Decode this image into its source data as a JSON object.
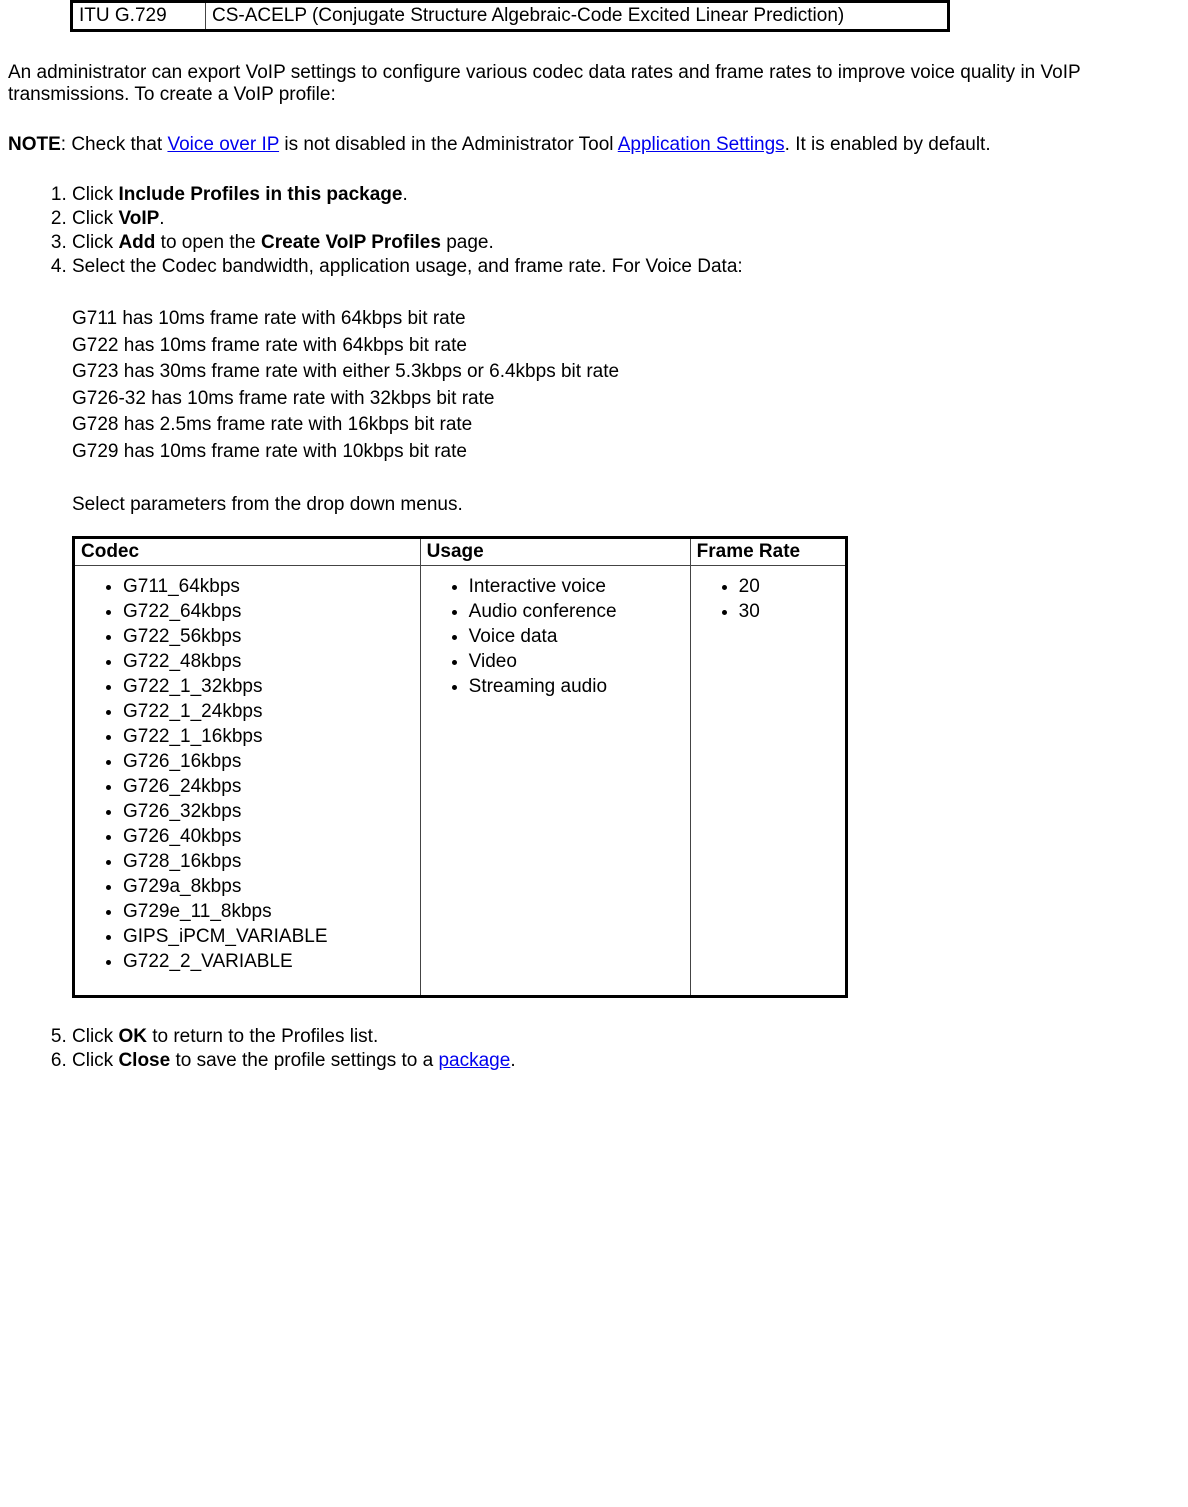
{
  "topTable": {
    "cell1": "ITU G.729",
    "cell2": "CS-ACELP (Conjugate Structure Algebraic-Code Excited Linear Prediction)"
  },
  "intro": "An administrator can export VoIP settings to configure various codec data rates and frame rates to improve voice quality in VoIP transmissions. To create a VoIP profile:",
  "note": {
    "prefix": "NOTE",
    "beforeLink1": ": Check that ",
    "link1": "Voice over IP",
    "middle": " is not disabled in the Administrator Tool ",
    "link2": "Application Settings",
    "after": ". It is enabled by default."
  },
  "steps": {
    "s1a": "Click ",
    "s1b": "Include Profiles in this package",
    "s1c": ".",
    "s2a": "Click ",
    "s2b": "VoIP",
    "s2c": ".",
    "s3a": "Click ",
    "s3b": "Add",
    "s3c": " to open the ",
    "s3d": "Create VoIP Profiles",
    "s3e": " page.",
    "s4": "Select the Codec bandwidth, application usage, and frame rate. For Voice Data:",
    "s5a": "Click ",
    "s5b": "OK",
    "s5c": " to return to the Profiles list.",
    "s6a": "Click ",
    "s6b": "Close",
    "s6c": " to save the profile settings to a ",
    "s6d": "package",
    "s6e": "."
  },
  "voiceData": [
    "G711 has 10ms frame rate with 64kbps bit rate",
    "G722 has 10ms frame rate with 64kbps bit rate",
    "G723 has 30ms frame rate with either 5.3kbps or 6.4kbps bit rate",
    "G726-32 has 10ms frame rate with 32kbps bit rate",
    "G728 has 2.5ms frame rate with 16kbps bit rate",
    "G729 has 10ms frame rate with 10kbps bit rate"
  ],
  "selectParams": "Select parameters from the drop down menus.",
  "paramTable": {
    "headers": [
      "Codec",
      "Usage",
      "Frame Rate"
    ],
    "codec": [
      "G711_64kbps",
      "G722_64kbps",
      "G722_56kbps",
      "G722_48kbps",
      "G722_1_32kbps",
      "G722_1_24kbps",
      "G722_1_16kbps",
      "G726_16kbps",
      "G726_24kbps",
      "G726_32kbps",
      "G726_40kbps",
      "G728_16kbps",
      "G729a_8kbps",
      "G729e_11_8kbps",
      "GIPS_iPCM_VARIABLE",
      "G722_2_VARIABLE"
    ],
    "usage": [
      "Interactive voice",
      "Audio conference",
      "Voice data",
      "Video",
      "Streaming audio"
    ],
    "frameRate": [
      "20",
      "30"
    ]
  }
}
